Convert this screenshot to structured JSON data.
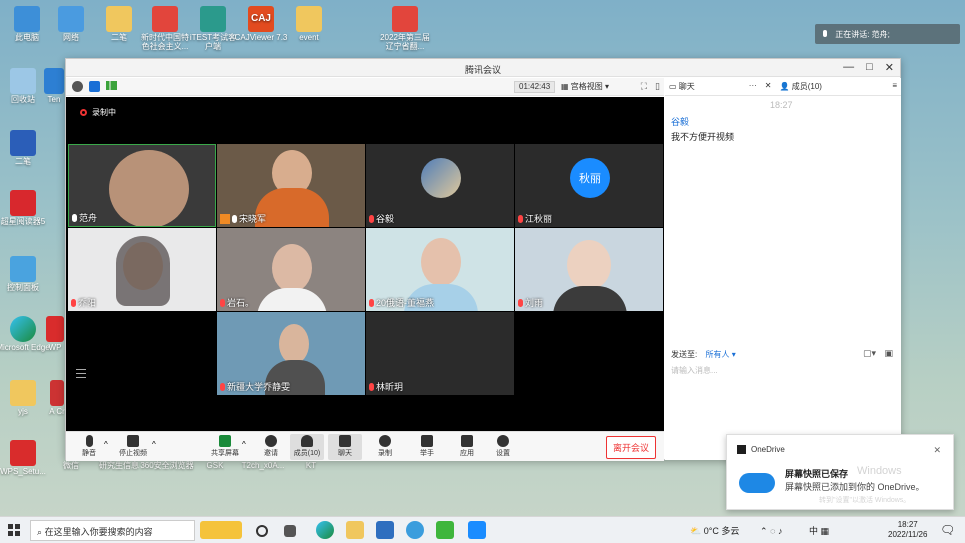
{
  "desktop": {
    "icons": [
      {
        "label": "此电脑"
      },
      {
        "label": "网络"
      },
      {
        "label": "二笔"
      },
      {
        "label": "新时代中国特色社会主义..."
      },
      {
        "label": "iTEST考试客户端"
      },
      {
        "label": "CAJViewer 7.3"
      },
      {
        "label": "event"
      },
      {
        "label": "2022年第三届辽宁省翻..."
      },
      {
        "label": "回收站"
      },
      {
        "label": "Ten"
      },
      {
        "label": "二笔"
      },
      {
        "label": "超星阅读器5"
      },
      {
        "label": "控制面板"
      },
      {
        "label": "Microsoft Edge"
      },
      {
        "label": "WP"
      },
      {
        "label": "yjs"
      },
      {
        "label": "A Cr"
      },
      {
        "label": "WPS_Setu..."
      },
      {
        "label": "微信"
      },
      {
        "label": "研究生信息"
      },
      {
        "label": "360安全浏览器"
      },
      {
        "label": "GSK"
      },
      {
        "label": "T2ch_x0A..."
      },
      {
        "label": "KT"
      }
    ]
  },
  "speaking_notice": "正在讲话: 范舟;",
  "window": {
    "title": "腾讯会议",
    "controls": {
      "minimize": "—",
      "maximize": "□",
      "close": "✕"
    },
    "toolbar": {
      "duration": "01:42:43",
      "view_label": "宫格视图"
    },
    "recording_label": "录制中",
    "participants": [
      {
        "name": "范舟",
        "mic": "on"
      },
      {
        "name": "宋晓军",
        "mic": "on"
      },
      {
        "name": "谷毅",
        "mic": "off"
      },
      {
        "name": "江秋丽",
        "mic": "off",
        "avatar_text": "秋丽"
      },
      {
        "name": "乔阳",
        "mic": "off"
      },
      {
        "name": "岩石。",
        "mic": "off"
      },
      {
        "name": "20俄语-董福燕",
        "mic": "off"
      },
      {
        "name": "刘雨",
        "mic": "off"
      },
      {
        "name": "新疆大学乔静雯",
        "mic": "off"
      },
      {
        "name": "林昕玥",
        "mic": "off"
      }
    ],
    "bottom_controls": [
      {
        "label": "静音"
      },
      {
        "label": "停止视频"
      },
      {
        "label": "共享屏幕"
      },
      {
        "label": "邀请"
      },
      {
        "label": "成员(10)"
      },
      {
        "label": "聊天"
      },
      {
        "label": "录制"
      },
      {
        "label": "举手"
      },
      {
        "label": "应用"
      },
      {
        "label": "设置"
      }
    ],
    "leave_label": "离开会议",
    "chat": {
      "tab_chat": "聊天",
      "tab_members": "成员(10)",
      "time": "18:27",
      "sender": "谷毅",
      "message": "我不方便开视频",
      "send_to_label": "发送至:",
      "send_to_value": "所有人",
      "input_placeholder": "请输入消息..."
    }
  },
  "onedrive": {
    "app": "OneDrive",
    "title": "屏幕快照已保存",
    "body": "屏幕快照已添加到你的 OneDrive。",
    "watermark": "Windows",
    "watermark2": "转到\"设置\"以激活 Windows。"
  },
  "taskbar": {
    "search_placeholder": "在这里输入你要搜索的内容",
    "weather": "0°C 多云",
    "ime": "中",
    "time": "18:27",
    "date": "2022/11/26"
  }
}
